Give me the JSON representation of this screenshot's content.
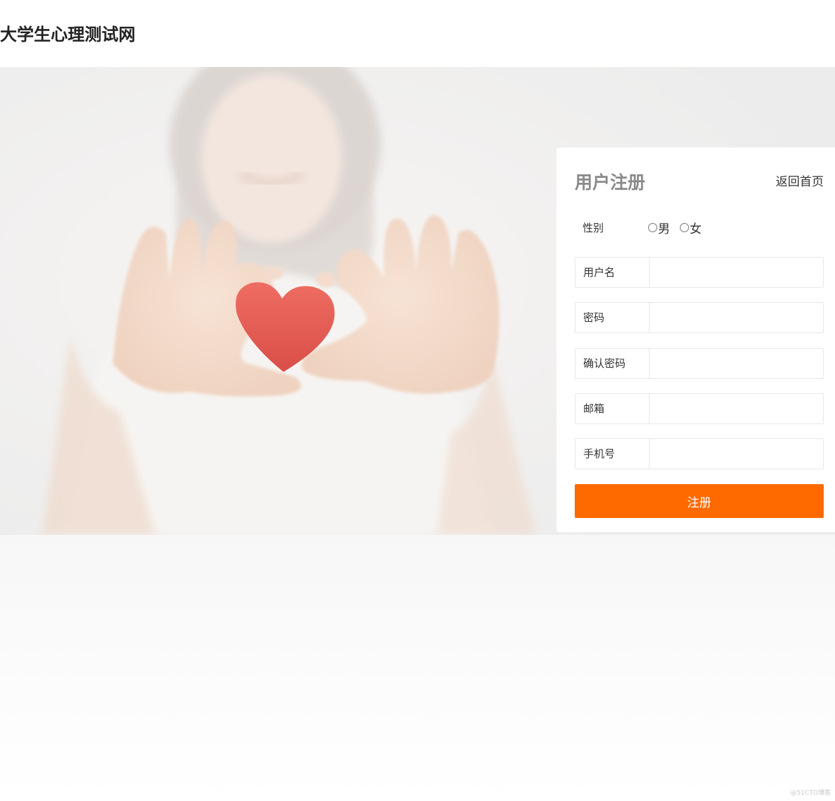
{
  "site": {
    "title": "大学生心理测试网"
  },
  "register": {
    "title": "用户注册",
    "back_home": "返回首页",
    "gender": {
      "label": "性别",
      "options": [
        "男",
        "女"
      ]
    },
    "fields": [
      {
        "label": "用户名",
        "value": ""
      },
      {
        "label": "密码",
        "value": ""
      },
      {
        "label": "确认密码",
        "value": ""
      },
      {
        "label": "邮箱",
        "value": ""
      },
      {
        "label": "手机号",
        "value": ""
      }
    ],
    "submit_label": "注册"
  },
  "watermark": "@51CTO博客",
  "colors": {
    "accent": "#ff6a00",
    "heart": "#e45a52"
  }
}
